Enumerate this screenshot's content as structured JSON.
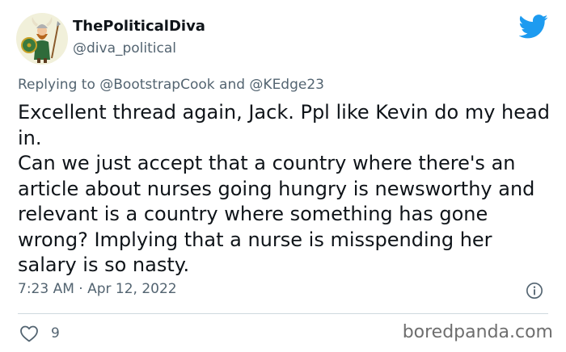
{
  "author": {
    "display_name": "ThePoliticalDiva",
    "handle": "@diva_political"
  },
  "reply": {
    "prefix": "Replying to",
    "mention_1": "@BootstrapCook",
    "conjunction": "and",
    "mention_2": "@KEdge23"
  },
  "tweet": {
    "paragraph_1": "Excellent thread again, Jack. Ppl like Kevin do my head in.",
    "paragraph_2": "Can we just accept that a country where there's an article about nurses going hungry is newsworthy and relevant is a country where something has gone wrong? Implying that a nurse is misspending her salary is so nasty.",
    "timestamp": "7:23 AM · Apr 12, 2022"
  },
  "actions": {
    "like_count": "9"
  },
  "watermark": "boredpanda.com",
  "colors": {
    "twitter_blue": "#1d9bf0",
    "muted_text": "#536471",
    "primary_text": "#0f1419",
    "divider": "#cfd9de"
  },
  "icons": {
    "brand": "twitter-bird-icon",
    "info": "info-icon",
    "like": "heart-icon"
  }
}
